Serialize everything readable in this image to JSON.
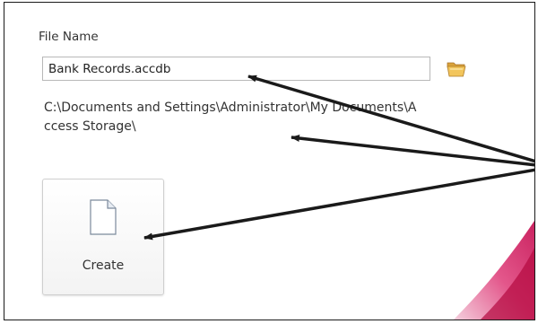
{
  "file_name": {
    "label": "File Name",
    "value": "Bank Records.accdb"
  },
  "save_path": "C:\\Documents and Settings\\Administrator\\My Documents\\Access Storage\\",
  "create_button": {
    "label": "Create"
  },
  "icons": {
    "browse": "folder-open-icon",
    "create": "new-document-icon"
  },
  "colors": {
    "accent": "#d4145a",
    "callout_arrow": "#1a1a1a",
    "folder": "#e8b44a"
  }
}
